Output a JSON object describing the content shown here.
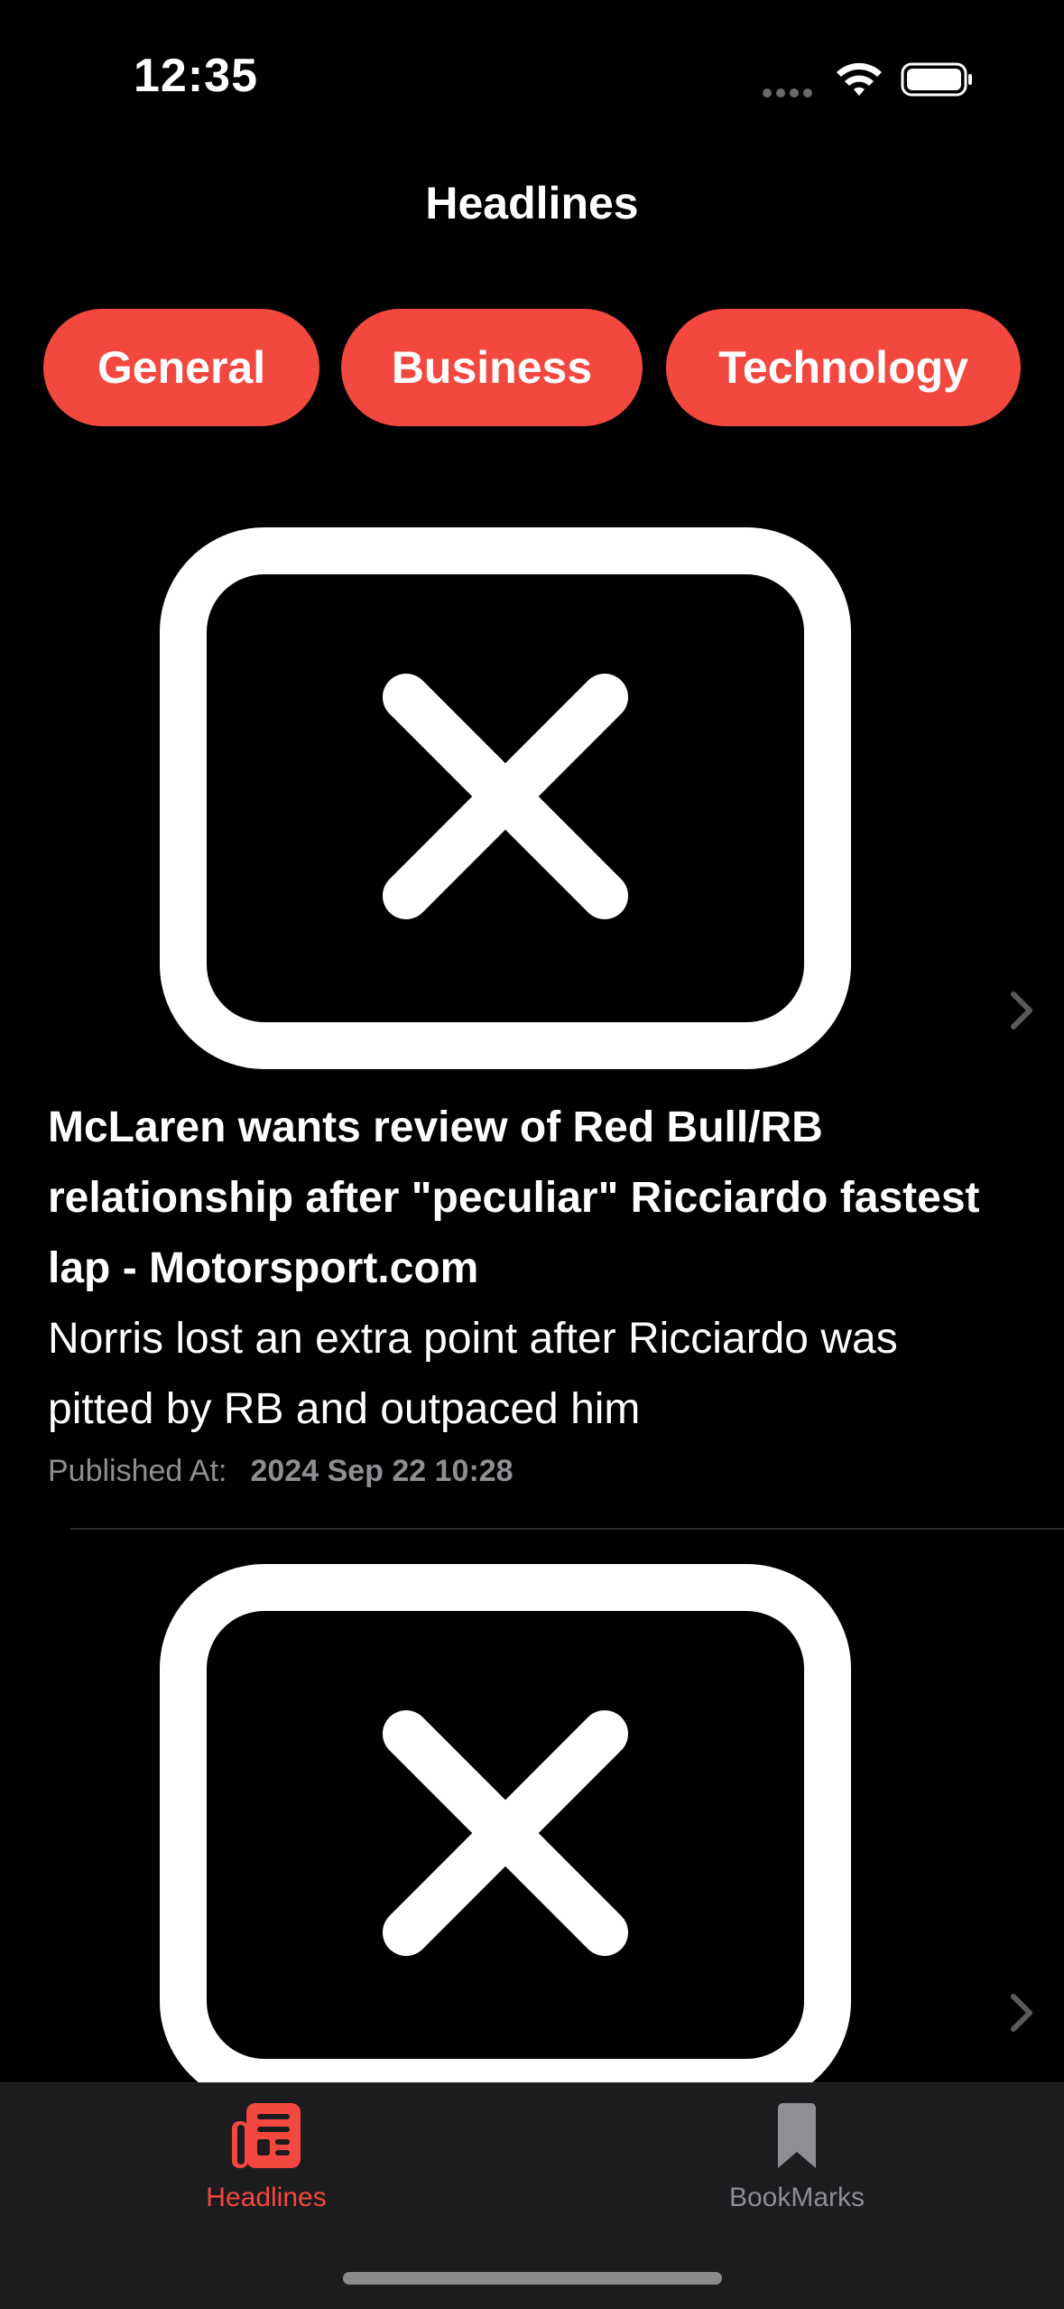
{
  "status_bar": {
    "time": "12:35"
  },
  "nav": {
    "title": "Headlines"
  },
  "categories": [
    {
      "label": "General"
    },
    {
      "label": "Business"
    },
    {
      "label": "Technology"
    }
  ],
  "articles": [
    {
      "title": "McLaren wants review of Red Bull/RB relationship after \"peculiar\" Ricciardo fastest lap - Motorsport.com",
      "description": "Norris lost an extra point after Ricciardo was pitted by RB and outpaced him",
      "published_label": "Published At:",
      "published_at": "2024 Sep 22 10:28",
      "image_icon": "broken-image-icon"
    },
    {
      "image_icon": "broken-image-icon"
    }
  ],
  "tab_bar": {
    "tabs": [
      {
        "label": "Headlines",
        "icon": "newspaper-icon",
        "selected": true
      },
      {
        "label": "BookMarks",
        "icon": "bookmark-icon",
        "selected": false
      }
    ]
  },
  "colors": {
    "accent": "#f3483f",
    "background": "#000000",
    "secondary_text": "#8e8e93",
    "tab_bar": "#1c1c1e"
  }
}
